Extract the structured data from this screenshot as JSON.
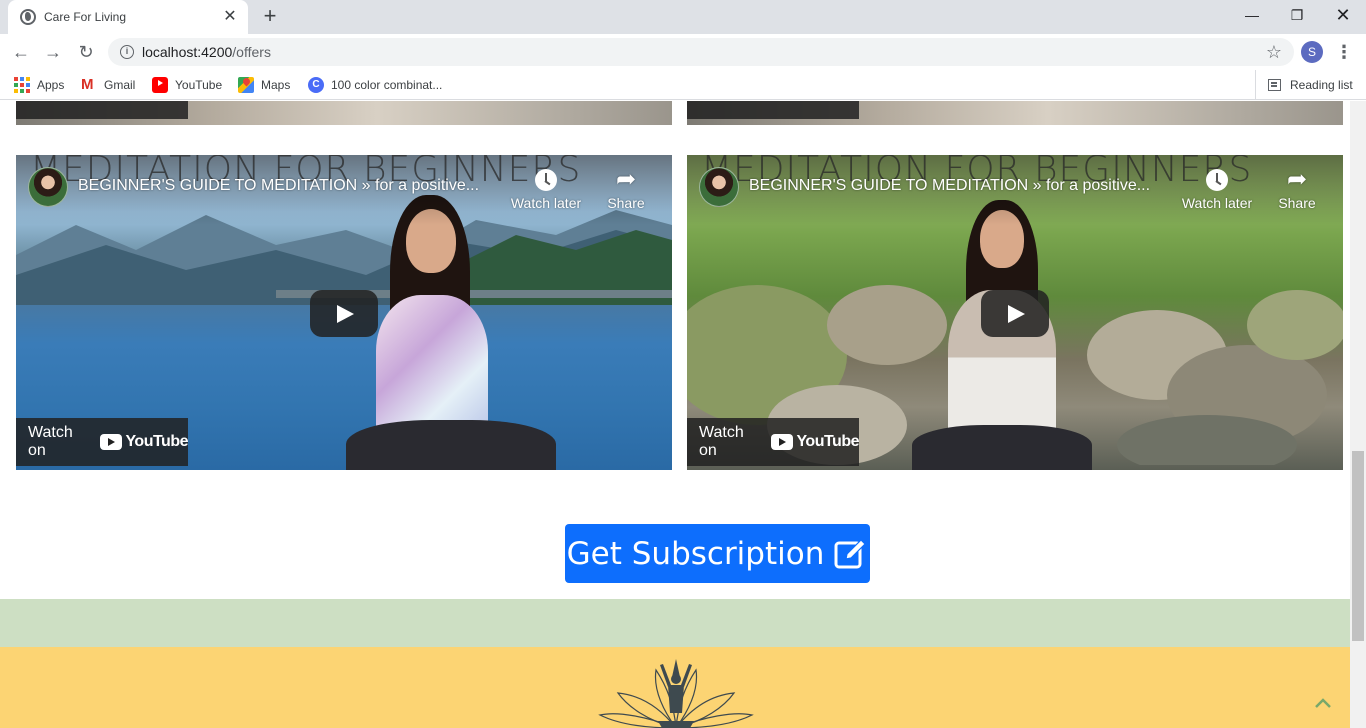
{
  "browser": {
    "tab_title": "Care For Living",
    "url_host": "localhost:4200",
    "url_path": "/offers",
    "profile_initial": "S",
    "bookmarks": [
      "Apps",
      "Gmail",
      "YouTube",
      "Maps",
      "100 color combinat..."
    ],
    "reading_list": "Reading list"
  },
  "videos": [
    {
      "background_text": "MEDITATION FOR BEGINNERS",
      "title": "BEGINNER'S GUIDE TO MEDITATION » for a positive...",
      "watch_later": "Watch later",
      "share": "Share",
      "watch_on": "Watch on",
      "platform": "YouTube"
    },
    {
      "background_text": "MEDITATION FOR BEGINNERS",
      "title": "BEGINNER'S GUIDE TO MEDITATION » for a positive...",
      "watch_later": "Watch later",
      "share": "Share",
      "watch_on": "Watch on",
      "platform": "YouTube"
    }
  ],
  "subscription_button": "Get Subscription",
  "colors": {
    "primary_button": "#0d6efd",
    "footer_green": "#cddfc3",
    "footer_yellow": "#fcd473"
  }
}
